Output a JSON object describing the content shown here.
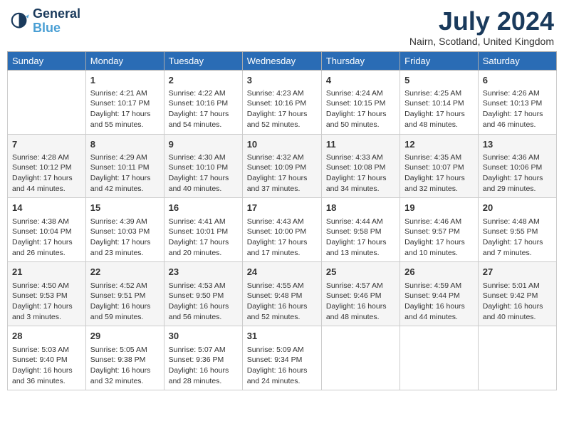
{
  "header": {
    "logo_line1": "General",
    "logo_line2": "Blue",
    "month": "July 2024",
    "location": "Nairn, Scotland, United Kingdom"
  },
  "days_of_week": [
    "Sunday",
    "Monday",
    "Tuesday",
    "Wednesday",
    "Thursday",
    "Friday",
    "Saturday"
  ],
  "weeks": [
    [
      {
        "day": "",
        "info": ""
      },
      {
        "day": "1",
        "info": "Sunrise: 4:21 AM\nSunset: 10:17 PM\nDaylight: 17 hours\nand 55 minutes."
      },
      {
        "day": "2",
        "info": "Sunrise: 4:22 AM\nSunset: 10:16 PM\nDaylight: 17 hours\nand 54 minutes."
      },
      {
        "day": "3",
        "info": "Sunrise: 4:23 AM\nSunset: 10:16 PM\nDaylight: 17 hours\nand 52 minutes."
      },
      {
        "day": "4",
        "info": "Sunrise: 4:24 AM\nSunset: 10:15 PM\nDaylight: 17 hours\nand 50 minutes."
      },
      {
        "day": "5",
        "info": "Sunrise: 4:25 AM\nSunset: 10:14 PM\nDaylight: 17 hours\nand 48 minutes."
      },
      {
        "day": "6",
        "info": "Sunrise: 4:26 AM\nSunset: 10:13 PM\nDaylight: 17 hours\nand 46 minutes."
      }
    ],
    [
      {
        "day": "7",
        "info": "Sunrise: 4:28 AM\nSunset: 10:12 PM\nDaylight: 17 hours\nand 44 minutes."
      },
      {
        "day": "8",
        "info": "Sunrise: 4:29 AM\nSunset: 10:11 PM\nDaylight: 17 hours\nand 42 minutes."
      },
      {
        "day": "9",
        "info": "Sunrise: 4:30 AM\nSunset: 10:10 PM\nDaylight: 17 hours\nand 40 minutes."
      },
      {
        "day": "10",
        "info": "Sunrise: 4:32 AM\nSunset: 10:09 PM\nDaylight: 17 hours\nand 37 minutes."
      },
      {
        "day": "11",
        "info": "Sunrise: 4:33 AM\nSunset: 10:08 PM\nDaylight: 17 hours\nand 34 minutes."
      },
      {
        "day": "12",
        "info": "Sunrise: 4:35 AM\nSunset: 10:07 PM\nDaylight: 17 hours\nand 32 minutes."
      },
      {
        "day": "13",
        "info": "Sunrise: 4:36 AM\nSunset: 10:06 PM\nDaylight: 17 hours\nand 29 minutes."
      }
    ],
    [
      {
        "day": "14",
        "info": "Sunrise: 4:38 AM\nSunset: 10:04 PM\nDaylight: 17 hours\nand 26 minutes."
      },
      {
        "day": "15",
        "info": "Sunrise: 4:39 AM\nSunset: 10:03 PM\nDaylight: 17 hours\nand 23 minutes."
      },
      {
        "day": "16",
        "info": "Sunrise: 4:41 AM\nSunset: 10:01 PM\nDaylight: 17 hours\nand 20 minutes."
      },
      {
        "day": "17",
        "info": "Sunrise: 4:43 AM\nSunset: 10:00 PM\nDaylight: 17 hours\nand 17 minutes."
      },
      {
        "day": "18",
        "info": "Sunrise: 4:44 AM\nSunset: 9:58 PM\nDaylight: 17 hours\nand 13 minutes."
      },
      {
        "day": "19",
        "info": "Sunrise: 4:46 AM\nSunset: 9:57 PM\nDaylight: 17 hours\nand 10 minutes."
      },
      {
        "day": "20",
        "info": "Sunrise: 4:48 AM\nSunset: 9:55 PM\nDaylight: 17 hours\nand 7 minutes."
      }
    ],
    [
      {
        "day": "21",
        "info": "Sunrise: 4:50 AM\nSunset: 9:53 PM\nDaylight: 17 hours\nand 3 minutes."
      },
      {
        "day": "22",
        "info": "Sunrise: 4:52 AM\nSunset: 9:51 PM\nDaylight: 16 hours\nand 59 minutes."
      },
      {
        "day": "23",
        "info": "Sunrise: 4:53 AM\nSunset: 9:50 PM\nDaylight: 16 hours\nand 56 minutes."
      },
      {
        "day": "24",
        "info": "Sunrise: 4:55 AM\nSunset: 9:48 PM\nDaylight: 16 hours\nand 52 minutes."
      },
      {
        "day": "25",
        "info": "Sunrise: 4:57 AM\nSunset: 9:46 PM\nDaylight: 16 hours\nand 48 minutes."
      },
      {
        "day": "26",
        "info": "Sunrise: 4:59 AM\nSunset: 9:44 PM\nDaylight: 16 hours\nand 44 minutes."
      },
      {
        "day": "27",
        "info": "Sunrise: 5:01 AM\nSunset: 9:42 PM\nDaylight: 16 hours\nand 40 minutes."
      }
    ],
    [
      {
        "day": "28",
        "info": "Sunrise: 5:03 AM\nSunset: 9:40 PM\nDaylight: 16 hours\nand 36 minutes."
      },
      {
        "day": "29",
        "info": "Sunrise: 5:05 AM\nSunset: 9:38 PM\nDaylight: 16 hours\nand 32 minutes."
      },
      {
        "day": "30",
        "info": "Sunrise: 5:07 AM\nSunset: 9:36 PM\nDaylight: 16 hours\nand 28 minutes."
      },
      {
        "day": "31",
        "info": "Sunrise: 5:09 AM\nSunset: 9:34 PM\nDaylight: 16 hours\nand 24 minutes."
      },
      {
        "day": "",
        "info": ""
      },
      {
        "day": "",
        "info": ""
      },
      {
        "day": "",
        "info": ""
      }
    ]
  ]
}
